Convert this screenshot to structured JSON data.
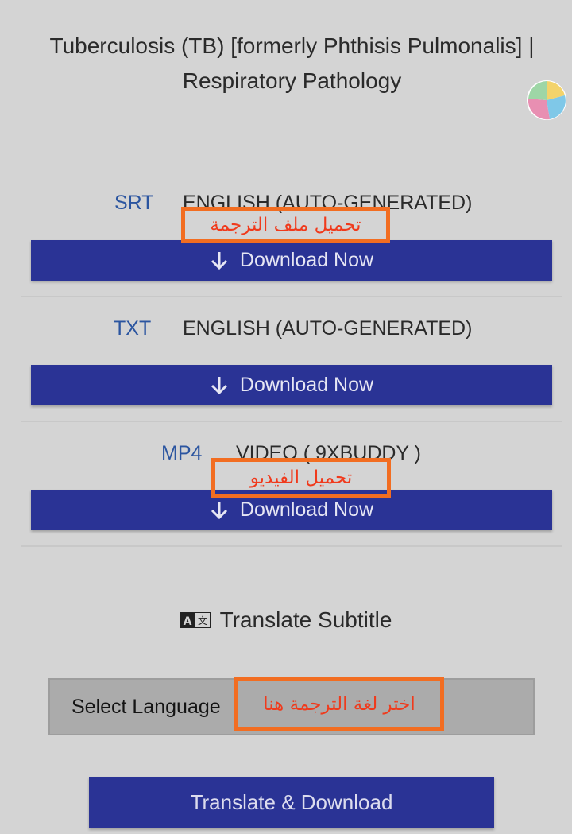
{
  "page": {
    "title_line1": "Tuberculosis (TB) [formerly Phthisis Pulmonalis] |",
    "title_line2": "Respiratory Pathology"
  },
  "downloads": [
    {
      "format": "SRT",
      "description": "ENGLISH (AUTO-GENERATED)",
      "button_label": "Download Now"
    },
    {
      "format": "TXT",
      "description": "ENGLISH (AUTO-GENERATED)",
      "button_label": "Download Now"
    },
    {
      "format": "MP4",
      "description": "VIDEO ( 9XBUDDY )",
      "button_label": "Download Now"
    }
  ],
  "annotations": {
    "subtitle_file": "تحميل ملف الترجمة",
    "video": "تحميل الفيديو",
    "language": "اختر لغة الترجمة هنا"
  },
  "translate": {
    "heading": "Translate Subtitle",
    "select_value": "Select Language",
    "button_label": "Translate & Download"
  },
  "colors": {
    "background": "#d4d4d4",
    "button": "#2a3395",
    "format_label": "#2b55a0",
    "annotation": "#f26d21"
  },
  "icons": {
    "download": "arrow-down-icon",
    "translate": "translate-icon",
    "logo": "logo-icon"
  }
}
